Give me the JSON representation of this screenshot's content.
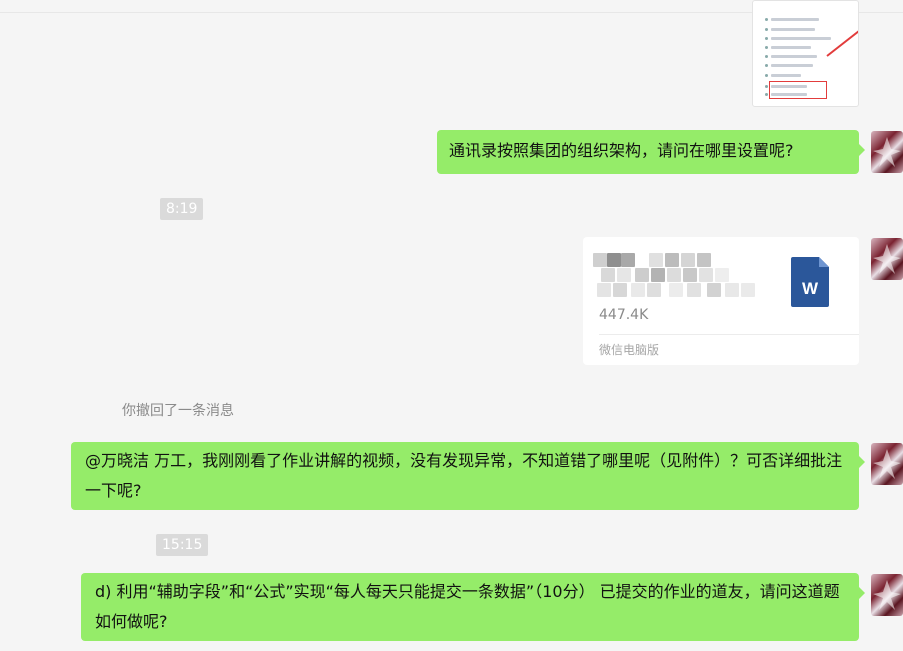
{
  "messages": {
    "msg1": "通讯录按照集团的组织架构，请问在哪里设置呢?",
    "time1": "8:19",
    "file": {
      "size": "447.4K",
      "source": "微信电脑版",
      "icon": "word-document-icon",
      "icon_letter": "W"
    },
    "recall_notice": "你撤回了一条消息",
    "msg2": "@万晓洁 万工，我刚刚看了作业讲解的视频，没有发现异常，不知道错了哪里呢（见附件）？可否详细批注一下呢?",
    "time2": "15:15",
    "msg3": "d) 利用“辅助字段”和“公式”实现“每人每天只能提交一条数据”（10分） 已提交的作业的道友，请问这道题如何做呢?"
  },
  "colors": {
    "bubble_green": "#95ec69",
    "background": "#f5f5f5",
    "word_blue": "#2b579a"
  }
}
